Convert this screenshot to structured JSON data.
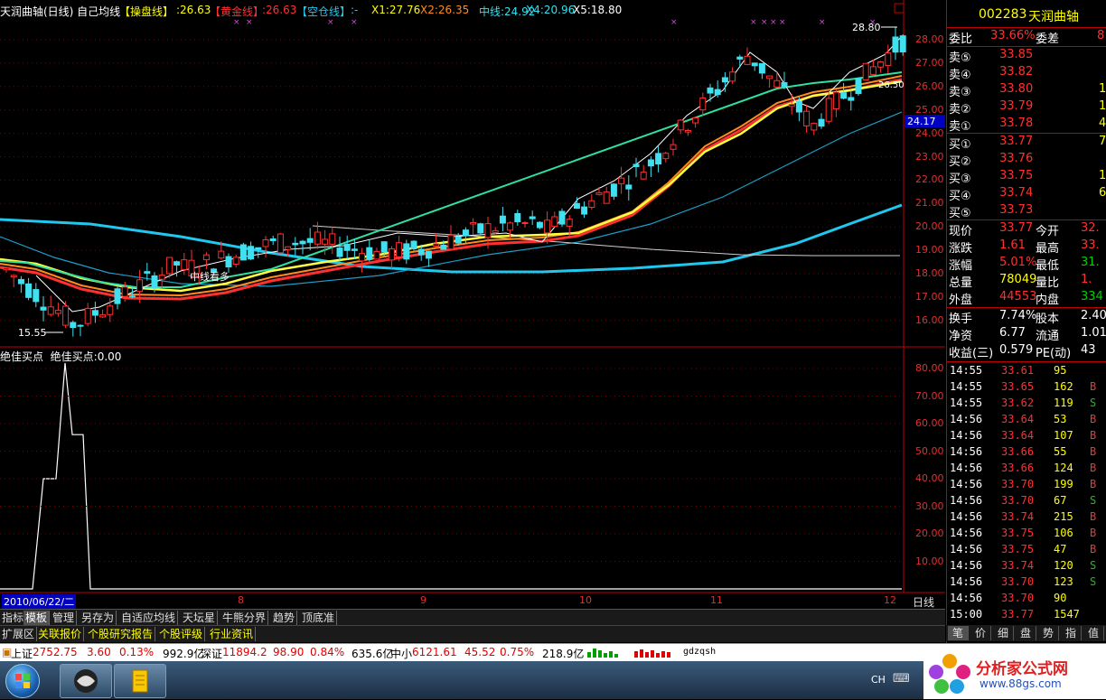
{
  "header": {
    "title": "天润曲轴(日线) 自己均线",
    "cao_label": "【操盘线】",
    "cao_value": ":26.63",
    "huang_label": "【黄金线】",
    "huang_value": ":26.63",
    "kong_label": "【空仓线】",
    "kong_value": ":-",
    "x1": "X1:27.76",
    "x2": "X2:26.35",
    "zhong": "中线:24.92",
    "x4": "X4:20.96",
    "x5": "X5:18.80"
  },
  "price_axis": [
    "28.00",
    "27.00",
    "26.00",
    "25.00",
    "24.00",
    "23.00",
    "22.00",
    "21.00",
    "20.00",
    "19.00",
    "18.00",
    "17.00",
    "16.00"
  ],
  "current_price_tag": "24.17",
  "annotations": {
    "high": "28.80",
    "low": "15.55",
    "mid_text": "中线看多",
    "right_val": "26.50"
  },
  "indicator": {
    "header_name": "绝佳买点",
    "header_value": "绝佳买点:0.00",
    "axis": [
      "80.00",
      "70.00",
      "60.00",
      "50.00",
      "40.00",
      "30.00",
      "20.00",
      "10.00"
    ]
  },
  "date_axis": {
    "date": "2010/06/22/二",
    "months": [
      "8",
      "9",
      "10",
      "11",
      "12"
    ],
    "period": "日线"
  },
  "right_panel": {
    "code": "002283",
    "name": "天润曲轴",
    "wei_bi_label": "委比",
    "wei_bi": "33.66%",
    "wei_cha_label": "委差",
    "wei_cha": "8",
    "sells": [
      {
        "label": "卖⑤",
        "price": "33.85",
        "vol": ""
      },
      {
        "label": "卖④",
        "price": "33.82",
        "vol": ""
      },
      {
        "label": "卖③",
        "price": "33.80",
        "vol": "1"
      },
      {
        "label": "卖②",
        "price": "33.79",
        "vol": "1"
      },
      {
        "label": "卖①",
        "price": "33.78",
        "vol": "4"
      }
    ],
    "buys": [
      {
        "label": "买①",
        "price": "33.77",
        "vol": "7"
      },
      {
        "label": "买②",
        "price": "33.76",
        "vol": ""
      },
      {
        "label": "买③",
        "price": "33.75",
        "vol": "1"
      },
      {
        "label": "买④",
        "price": "33.74",
        "vol": "6"
      },
      {
        "label": "买⑤",
        "price": "33.73",
        "vol": ""
      }
    ],
    "quote": [
      {
        "l1": "现价",
        "v1": "33.77",
        "l2": "今开",
        "v2": "32."
      },
      {
        "l1": "涨跌",
        "v1": "1.61",
        "l2": "最高",
        "v2": "33."
      },
      {
        "l1": "涨幅",
        "v1": "5.01%",
        "l2": "最低",
        "v2": "31."
      },
      {
        "l1": "总量",
        "v1": "78049",
        "l2": "量比",
        "v2": "1."
      },
      {
        "l1": "外盘",
        "v1": "44553",
        "l2": "内盘",
        "v2": "334"
      }
    ],
    "stats": [
      {
        "l1": "换手",
        "v1": "7.74%",
        "l2": "股本",
        "v2": "2.40"
      },
      {
        "l1": "净资",
        "v1": "6.77",
        "l2": "流通",
        "v2": "1.01"
      },
      {
        "l1": "收益(三)",
        "v1": "0.579",
        "l2": "PE(动)",
        "v2": "43"
      }
    ],
    "ticks": [
      {
        "t": "14:55",
        "p": "33.61",
        "v": "95",
        "s": ""
      },
      {
        "t": "14:55",
        "p": "33.65",
        "v": "162",
        "s": "B"
      },
      {
        "t": "14:55",
        "p": "33.62",
        "v": "119",
        "s": "S"
      },
      {
        "t": "14:56",
        "p": "33.64",
        "v": "53",
        "s": "B"
      },
      {
        "t": "14:56",
        "p": "33.64",
        "v": "107",
        "s": "B"
      },
      {
        "t": "14:56",
        "p": "33.66",
        "v": "55",
        "s": "B"
      },
      {
        "t": "14:56",
        "p": "33.66",
        "v": "124",
        "s": "B"
      },
      {
        "t": "14:56",
        "p": "33.70",
        "v": "199",
        "s": "B"
      },
      {
        "t": "14:56",
        "p": "33.70",
        "v": "67",
        "s": "S"
      },
      {
        "t": "14:56",
        "p": "33.74",
        "v": "215",
        "s": "B"
      },
      {
        "t": "14:56",
        "p": "33.75",
        "v": "106",
        "s": "B"
      },
      {
        "t": "14:56",
        "p": "33.75",
        "v": "47",
        "s": "B"
      },
      {
        "t": "14:56",
        "p": "33.74",
        "v": "120",
        "s": "S"
      },
      {
        "t": "14:56",
        "p": "33.70",
        "v": "123",
        "s": "S"
      },
      {
        "t": "14:56",
        "p": "33.70",
        "v": "90",
        "s": ""
      },
      {
        "t": "15:00",
        "p": "33.77",
        "v": "1547",
        "s": ""
      }
    ],
    "tabs": [
      "笔",
      "价",
      "细",
      "盘",
      "势",
      "指",
      "值"
    ]
  },
  "bottom_tabs": [
    "指标",
    "模板",
    "管理",
    "另存为",
    "自适应均线",
    "天坛星",
    "牛熊分界",
    "趋势",
    "顶底准"
  ],
  "bottom_tabs2": [
    "扩展区",
    "关联报价",
    "个股研究报告",
    "个股评级",
    "行业资讯"
  ],
  "status": {
    "sh_name": "上证",
    "sh_val": "2752.75",
    "sh_chg": "3.60",
    "sh_pct": "0.13%",
    "sh_amt": "992.9亿",
    "sz_name": "深证",
    "sz_val": "11894.2",
    "sz_chg": "98.90",
    "sz_pct": "0.84%",
    "sz_amt": "635.6亿",
    "zx_name": "中小",
    "zx_val": "6121.61",
    "zx_chg": "45.52",
    "zx_pct": "0.75%",
    "zx_amt": "218.9亿",
    "code_input": "gdzqsh"
  },
  "taskbar": {
    "ime": "CH",
    "watermark": "分析家公式网",
    "watermark_url": "www.88gs.com"
  }
}
